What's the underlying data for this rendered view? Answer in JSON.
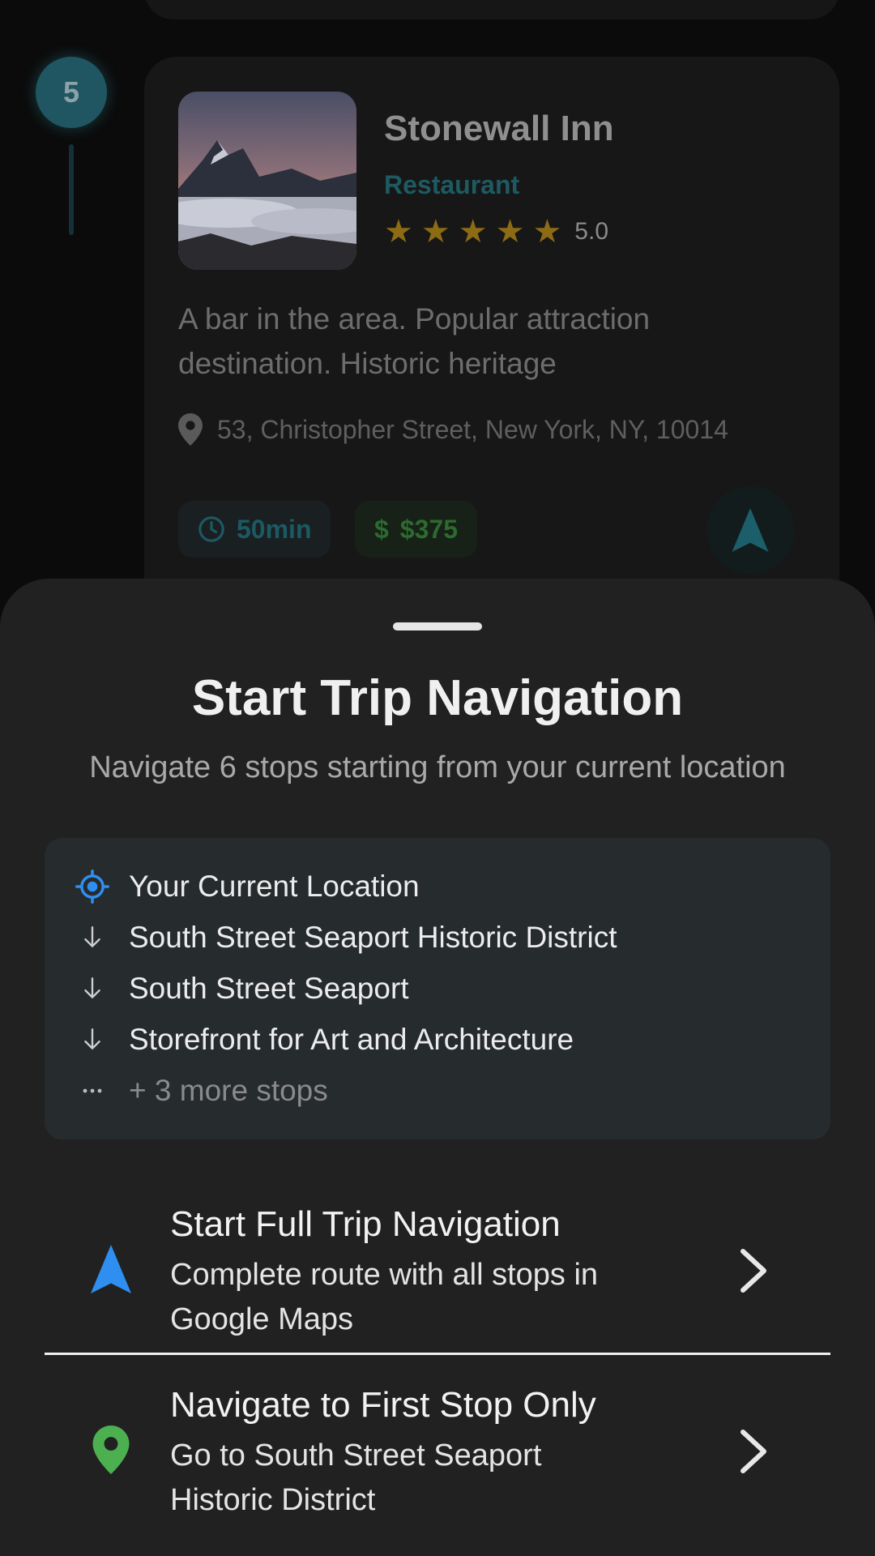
{
  "stop_card": {
    "number": "5",
    "name": "Stonewall Inn",
    "category": "Restaurant",
    "rating": 5.0,
    "rating_label": "5.0",
    "description": "A bar in the area. Popular attraction destination. Historic heritage",
    "address": "53, Christopher Street, New York, NY, 10014",
    "duration": "50min",
    "price_symbol": "$",
    "price": "$375",
    "colors": {
      "category": "#1d5a62",
      "star": "#8c6b14",
      "price": "#2c6a2f"
    }
  },
  "sheet": {
    "title": "Start Trip Navigation",
    "subtitle": "Navigate 6 stops starting from your current location",
    "route": {
      "origin": "Your Current Location",
      "stops": [
        "South Street Seaport Historic District",
        "South Street Seaport",
        "Storefront for Art and Architecture"
      ],
      "more": "+ 3 more stops"
    },
    "options": [
      {
        "title": "Start Full Trip Navigation",
        "description": "Complete route with all stops in Google Maps",
        "icon": "navigation-arrow-icon",
        "color": "#2e8ff0"
      },
      {
        "title": "Navigate to First Stop Only",
        "description": "Go to South Street Seaport Historic District",
        "icon": "map-pin-icon",
        "color": "#4caf50"
      }
    ]
  }
}
